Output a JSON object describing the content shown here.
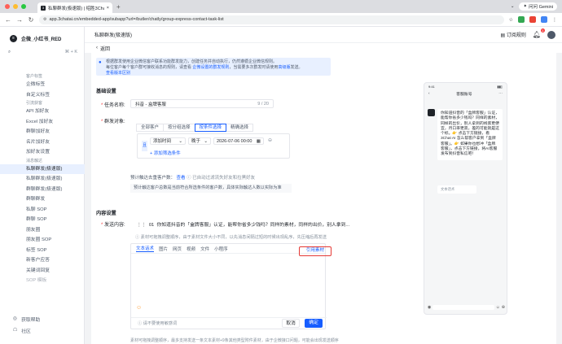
{
  "browser": {
    "tab_title": "私聊群发(极速版) | 绍胜3Chat...",
    "tab_favicon": "3",
    "url": "app.3chatai.cn/embedded-app/subapp?url=/butler/chatly/group-express-contact-task-list",
    "gemini_label": "问问 Gemini"
  },
  "sidebar": {
    "account_name": "企微_小红书_RED",
    "search_kbd": "⌘ + K",
    "items": [
      {
        "label": "客户标签",
        "type": "group"
      },
      {
        "label": "企微标签",
        "type": "item"
      },
      {
        "label": "自定义标签",
        "type": "item"
      },
      {
        "label": "引流获客",
        "type": "group"
      },
      {
        "label": "API 加好友",
        "type": "item"
      },
      {
        "label": "Excel 加好友",
        "type": "item"
      },
      {
        "label": "群聊加好友",
        "type": "item"
      },
      {
        "label": "名片加好友",
        "type": "item"
      },
      {
        "label": "加好友设置",
        "type": "item"
      },
      {
        "label": "消息触达",
        "type": "group"
      },
      {
        "label": "私聊群发(极速版)",
        "type": "active"
      },
      {
        "label": "私聊群发(极速版)",
        "type": "item"
      },
      {
        "label": "群聊群发(极速版)",
        "type": "item"
      },
      {
        "label": "群聊群发",
        "type": "item"
      },
      {
        "label": "私聊 SOP",
        "type": "item"
      },
      {
        "label": "群聊 SOP",
        "type": "item"
      },
      {
        "label": "朋友圈",
        "type": "item"
      },
      {
        "label": "朋友圈 SOP",
        "type": "item"
      },
      {
        "label": "标签 SOP",
        "type": "item"
      },
      {
        "label": "新客户应答",
        "type": "item"
      },
      {
        "label": "关键词回复",
        "type": "item"
      },
      {
        "label": "SOP 模板",
        "type": "dim"
      }
    ],
    "footer": [
      {
        "label": "获取帮助"
      },
      {
        "label": "社区"
      }
    ]
  },
  "topbar": {
    "breadcrumb": "私聊群发(极速版)",
    "subscribe_label": "订阅规则",
    "badge_count": "1"
  },
  "subhead": {
    "back_label": "返回"
  },
  "notice": {
    "line1": "根据群发使用企业微信客户联系功能群发能力，创建任务并自动执行，仍然遵循企业微信规则。",
    "line2_prefix": "每位客户每个客户群可接收消息的规则，请查看 ",
    "line2_link1": "企微设置的群发规则",
    "line2_mid": "，当需要多次群发时请使用",
    "line2_link2": "高级版",
    "line2_suffix": "发送。",
    "line3_link": "查看版本区别"
  },
  "basic": {
    "section_title": "基础设置",
    "task_name_label": "任务名称:",
    "task_name_value": "抖音 - 盒牌客服",
    "task_name_count": "9 / 20",
    "target_label": "群发对象:",
    "segments": [
      "全部客户",
      "按分组选择",
      "按条件选择",
      "精确选择"
    ],
    "cond_tag": "且",
    "cond_field": "添加时间",
    "cond_op": "晚于",
    "cond_value": "2026-07-06 00:00",
    "add_cond": "+ 添加筛选条件",
    "reach_prefix": "预计触达去重客户数：",
    "reach_link": "查看",
    "reach_info": "已自动过滤流失好友和拉黑好友",
    "hint": "预计触达客户总数是当前符合所选条件的客户数，具体实际触达人数以实际为准"
  },
  "content": {
    "section_title": "内容设置",
    "send_label": "发送内容:",
    "line_prefix": "01",
    "line_text": "你知道抖音的「盒牌客服」认证，能帮你省多少钱吗？同样的素材，同样的出价，别人拿到...",
    "tip": "素材可拖拽调整顺序，由于素材文件大小不同，以先消息间隔过短的时候出现乱序，先压缩后再发送",
    "editor_tabs": [
      "文本话术",
      "图片",
      "网页",
      "视频",
      "文件",
      "小程序"
    ],
    "quote_button": "引用素材",
    "editor_placeholder": "请不要使用敏感词",
    "cancel_label": "取消",
    "ok_label": "确定",
    "bottom_note": "素材可拖拽调整顺序，最多支持发送一条文本素材+9条其他类型附件素材，由于企微接口问题，可能会出现发送顺序"
  },
  "phone": {
    "time": "9:41",
    "title": "客服账号",
    "bubble": "你知道抖音的「盒牌客服」认证，能帮你省多少钱吗？同样的素材，同样的出价，别人拿到的线索更便宜，月口率更高，差的可能就是这个标。👉 点击下方链接，看 3Chat AI 怎么帮客户拿到「盒牌客服」。👉 如果你也想冲「盒牌客服」，点击下方链接，将AI客服发布到抖音私信吧！",
    "bubble2": "文本话术"
  },
  "colors": {
    "accent": "#165dff",
    "highlight": "#e53935"
  }
}
